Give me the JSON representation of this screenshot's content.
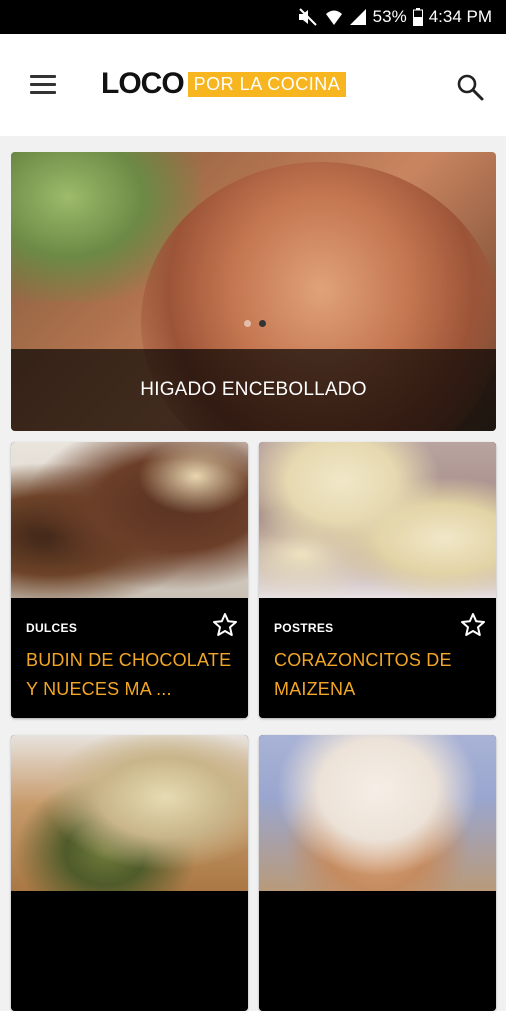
{
  "status_bar": {
    "battery_text": "53%",
    "time": "4:34 PM",
    "icons": [
      "mute-icon",
      "wifi-icon",
      "signal-icon",
      "battery-icon"
    ]
  },
  "header": {
    "logo_main": "LOCO",
    "logo_sub": "POR LA COCINA",
    "brand_accent": "#f7b51f",
    "icons": [
      "menu-icon",
      "search-icon"
    ]
  },
  "featured": {
    "title": "HIGADO ENCEBOLLADO",
    "carousel_pages": 2,
    "carousel_active": 1
  },
  "recipes": [
    {
      "category": "DULCES",
      "title": "BUDIN DE CHOCOLATE Y NUECES MA ...",
      "favorited": false
    },
    {
      "category": "POSTRES",
      "title": "CORAZONCITOS DE MAIZENA",
      "favorited": false
    },
    {
      "category": "",
      "title": "",
      "favorited": false
    },
    {
      "category": "",
      "title": "",
      "favorited": false
    }
  ],
  "colors": {
    "title_accent": "#f2a626",
    "card_info_bg": "#000000",
    "page_bg": "#f1f1f1"
  }
}
